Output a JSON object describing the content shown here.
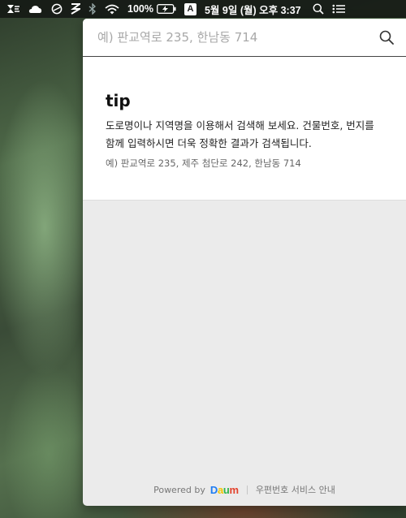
{
  "menubar": {
    "battery_percent": "100%",
    "input_method": "A",
    "clock": "5월 9일 (월) 오후 3:37",
    "icons": [
      "app-icon",
      "cloud-icon",
      "sync-icon",
      "logo-icon",
      "bluetooth-icon",
      "wifi-icon",
      "battery-charging-icon",
      "input-source-icon",
      "spotlight-icon",
      "notification-center-icon"
    ]
  },
  "search": {
    "placeholder": "예) 판교역로 235, 한남동 714",
    "value": ""
  },
  "tip": {
    "title": "tip",
    "description": "도로명이나 지역명을 이용해서 검색해 보세요. 건물번호, 번지를 함께 입력하시면 더욱 정확한 결과가 검색됩니다.",
    "example": "예) 판교역로 235, 제주 첨단로 242, 한남동 714"
  },
  "footer": {
    "powered_by": "Powered by",
    "brand_letters": [
      "D",
      "a",
      "u",
      "m"
    ],
    "brand_colors": [
      "#1e7cf2",
      "#f2c500",
      "#2fb54b",
      "#e3422c"
    ],
    "service_link": "우편번호 서비스 안내"
  }
}
